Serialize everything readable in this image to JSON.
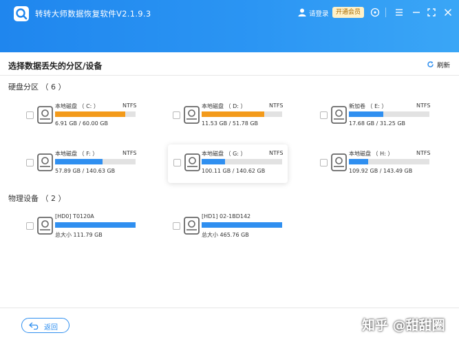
{
  "app": {
    "title": "转转大师数据恢复软件V2.1.9.3",
    "login_label": "请登录",
    "vip_label": "开通会员"
  },
  "page": {
    "title": "选择数据丢失的分区/设备",
    "refresh_label": "刷新"
  },
  "disk_section": {
    "title": "硬盘分区 （ 6 ）",
    "partitions": [
      {
        "name": "本地磁盘 （ C: ）",
        "fs": "NTFS",
        "usage": "6.91 GB / 60.00 GB",
        "fraction": 0.87,
        "color": "#f39a1a"
      },
      {
        "name": "本地磁盘 （ D: ）",
        "fs": "NTFS",
        "usage": "11.53 GB / 51.78 GB",
        "fraction": 0.78,
        "color": "#f39a1a"
      },
      {
        "name": "新加卷 （ E: ）",
        "fs": "NTFS",
        "usage": "17.68 GB / 31.25 GB",
        "fraction": 0.43,
        "color": "#2f8ff0"
      },
      {
        "name": "本地磁盘 （ F: ）",
        "fs": "NTFS",
        "usage": "57.89 GB / 140.63 GB",
        "fraction": 0.59,
        "color": "#2f8ff0"
      },
      {
        "name": "本地磁盘 （ G: ）",
        "fs": "NTFS",
        "usage": "100.11 GB / 140.62 GB",
        "fraction": 0.29,
        "color": "#2f8ff0"
      },
      {
        "name": "本地磁盘 （ H: ）",
        "fs": "NTFS",
        "usage": "109.92 GB / 143.49 GB",
        "fraction": 0.24,
        "color": "#2f8ff0"
      }
    ]
  },
  "physical_section": {
    "title": "物理设备 （ 2 ）",
    "devices": [
      {
        "name": "[HD0] T0120A",
        "usage": "总大小 111.79 GB",
        "color": "#2f8ff0"
      },
      {
        "name": "[HD1] 02-1BD142",
        "usage": "总大小 465.76 GB",
        "color": "#2f8ff0"
      }
    ]
  },
  "footer": {
    "back_label": "返回",
    "watermark": "知乎 @甜甜圈"
  }
}
